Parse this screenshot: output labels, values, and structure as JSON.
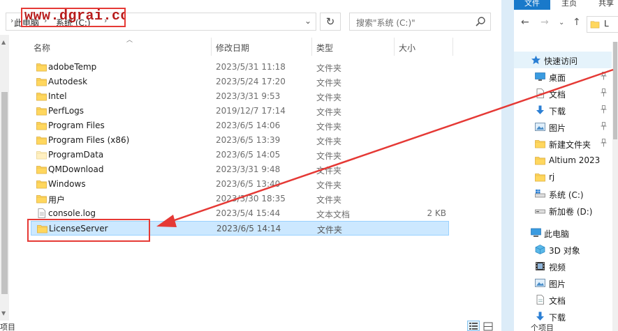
{
  "watermark": {
    "text": "www.dgrai.com"
  },
  "left_window": {
    "breadcrumb": [
      "此电脑",
      "系统 (C:)"
    ],
    "search": {
      "placeholder": "搜索\"系统 (C:)\""
    },
    "columns": [
      "名称",
      "修改日期",
      "类型",
      "大小"
    ],
    "files": [
      {
        "name": "adobeTemp",
        "date": "2023/5/31 11:18",
        "type": "文件夹",
        "size": "",
        "icon": "folder-icon"
      },
      {
        "name": "Autodesk",
        "date": "2023/5/24 17:20",
        "type": "文件夹",
        "size": "",
        "icon": "folder-icon"
      },
      {
        "name": "Intel",
        "date": "2023/3/31 9:53",
        "type": "文件夹",
        "size": "",
        "icon": "folder-icon"
      },
      {
        "name": "PerfLogs",
        "date": "2019/12/7 17:14",
        "type": "文件夹",
        "size": "",
        "icon": "folder-icon"
      },
      {
        "name": "Program Files",
        "date": "2023/6/5 14:06",
        "type": "文件夹",
        "size": "",
        "icon": "folder-icon"
      },
      {
        "name": "Program Files (x86)",
        "date": "2023/6/5 13:39",
        "type": "文件夹",
        "size": "",
        "icon": "folder-icon"
      },
      {
        "name": "ProgramData",
        "date": "2023/6/5 14:05",
        "type": "文件夹",
        "size": "",
        "icon": "folder-icon-faded"
      },
      {
        "name": "QMDownload",
        "date": "2023/3/31 9:48",
        "type": "文件夹",
        "size": "",
        "icon": "folder-icon"
      },
      {
        "name": "Windows",
        "date": "2023/6/5 13:40",
        "type": "文件夹",
        "size": "",
        "icon": "folder-icon"
      },
      {
        "name": "用户",
        "date": "2023/3/30 18:35",
        "type": "文件夹",
        "size": "",
        "icon": "folder-icon"
      },
      {
        "name": "console.log",
        "date": "2023/5/4 15:44",
        "type": "文本文档",
        "size": "2 KB",
        "icon": "text-file-icon"
      },
      {
        "name": "LicenseServer",
        "date": "2023/6/5 14:14",
        "type": "文件夹",
        "size": "",
        "icon": "folder-icon",
        "selected": true
      }
    ],
    "status": "项目"
  },
  "right_window": {
    "ribbon_tabs": [
      "文件",
      "主页",
      "共享"
    ],
    "nav_items": [
      {
        "label": "快速访问",
        "icon": "star-icon",
        "pinned": false
      },
      {
        "label": "桌面",
        "icon": "desktop-icon",
        "pinned": true
      },
      {
        "label": "文档",
        "icon": "document-icon",
        "pinned": true
      },
      {
        "label": "下载",
        "icon": "download-icon",
        "pinned": true
      },
      {
        "label": "图片",
        "icon": "picture-icon",
        "pinned": true
      },
      {
        "label": "新建文件夹",
        "icon": "folder-icon",
        "pinned": true
      },
      {
        "label": "Altium 2023",
        "icon": "folder-icon",
        "pinned": false
      },
      {
        "label": "rj",
        "icon": "folder-icon",
        "pinned": false
      },
      {
        "label": "系统 (C:)",
        "icon": "system-drive-icon",
        "pinned": false
      },
      {
        "label": "新加卷 (D:)",
        "icon": "drive-icon",
        "pinned": false
      },
      {
        "label": "此电脑",
        "icon": "computer-icon",
        "pinned": false
      },
      {
        "label": "3D 对象",
        "icon": "3d-objects-icon",
        "pinned": false
      },
      {
        "label": "视频",
        "icon": "video-icon",
        "pinned": false
      },
      {
        "label": "图片",
        "icon": "picture-icon",
        "pinned": false
      },
      {
        "label": "文档",
        "icon": "document-icon",
        "pinned": false
      },
      {
        "label": "下载",
        "icon": "download-icon",
        "pinned": false
      }
    ],
    "status": "个项目"
  },
  "colors": {
    "selection_bg": "#cce8ff",
    "selection_border": "#99d1ff",
    "annotation_red": "#e53935",
    "folder_yellow": "#ffd75e",
    "accent_blue": "#1979ca"
  }
}
